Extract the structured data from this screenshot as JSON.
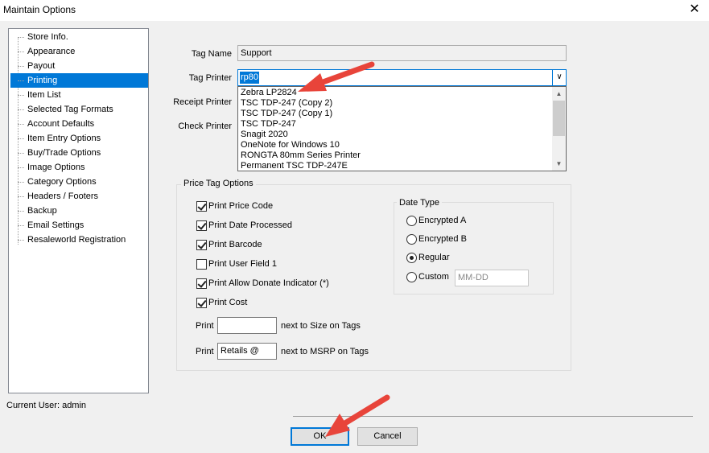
{
  "window": {
    "title": "Maintain Options",
    "close_glyph": "✕"
  },
  "sidebar": {
    "items": [
      {
        "label": "Store Info."
      },
      {
        "label": "Appearance"
      },
      {
        "label": "Payout"
      },
      {
        "label": "Printing",
        "selected": true
      },
      {
        "label": "Item List"
      },
      {
        "label": "Selected Tag Formats"
      },
      {
        "label": "Account Defaults"
      },
      {
        "label": "Item Entry Options"
      },
      {
        "label": "Buy/Trade Options"
      },
      {
        "label": "Image Options"
      },
      {
        "label": "Category Options"
      },
      {
        "label": "Headers / Footers"
      },
      {
        "label": "Backup"
      },
      {
        "label": "Email Settings"
      },
      {
        "label": "Resaleworld Registration"
      }
    ]
  },
  "form": {
    "tag_name": {
      "label": "Tag Name",
      "value": "Support"
    },
    "tag_printer": {
      "label": "Tag Printer",
      "value": "rp80"
    },
    "receipt_printer": {
      "label": "Receipt Printer"
    },
    "check_printer": {
      "label": "Check Printer"
    },
    "printer_options": [
      "Zebra LP2824",
      "TSC TDP-247 (Copy 2)",
      "TSC TDP-247 (Copy 1)",
      "TSC TDP-247",
      "Snagit 2020",
      "OneNote for Windows 10",
      "RONGTA 80mm Series Printer",
      "Permanent TSC TDP-247E"
    ]
  },
  "price_tag_options": {
    "title": "Price Tag Options",
    "checkboxes": [
      {
        "label": "Print Price Code",
        "checked": true
      },
      {
        "label": "Print Date Processed",
        "checked": true
      },
      {
        "label": "Print Barcode",
        "checked": true
      },
      {
        "label": "Print User Field 1",
        "checked": false
      },
      {
        "label": "Print Allow Donate Indicator (*)",
        "checked": true
      },
      {
        "label": "Print Cost",
        "checked": true
      }
    ],
    "print_size": {
      "prefix": "Print",
      "value": "",
      "suffix": "next to Size on Tags"
    },
    "print_msrp": {
      "prefix": "Print",
      "value": "Retails @",
      "suffix": "next to MSRP on Tags"
    },
    "date_type": {
      "title": "Date Type",
      "options": [
        {
          "label": "Encrypted A",
          "selected": false
        },
        {
          "label": "Encrypted B",
          "selected": false
        },
        {
          "label": "Regular",
          "selected": true
        },
        {
          "label": "Custom",
          "selected": false
        }
      ],
      "custom_placeholder": "MM-DD"
    }
  },
  "footer": {
    "current_user": "Current User: admin",
    "ok_label": "OK",
    "cancel_label": "Cancel"
  },
  "annotations": {
    "arrow_color": "#e8443a"
  }
}
